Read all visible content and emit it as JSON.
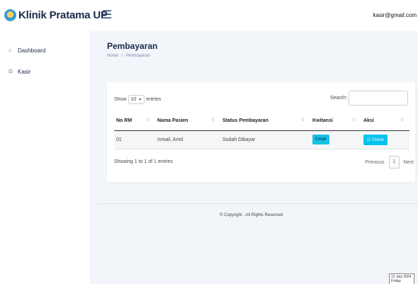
{
  "brand": {
    "name": "Klinik Pratama UP",
    "menu_icon": "hamburger-icon"
  },
  "user": {
    "email": "kasir@gmail.com"
  },
  "sidebar": {
    "items": [
      {
        "label": "Dashboard",
        "icon": "home-icon"
      },
      {
        "label": "Kasir",
        "icon": "cash-icon"
      }
    ]
  },
  "page": {
    "title": "Pembayaran",
    "breadcrumb": {
      "home": "Home",
      "sep": "/",
      "current": "Pembayaran"
    }
  },
  "table_controls": {
    "show_label": "Show",
    "length_value": "10",
    "entries_label": "entries",
    "search_label": "Search:",
    "search_value": ""
  },
  "table": {
    "headers": [
      "No RM",
      "Nama Pasien",
      "Status Pembayaran",
      "Kwitansi",
      "Aksi"
    ],
    "rows": [
      {
        "no_rm": "01",
        "nama": "Ismail, Amd",
        "status": "Sudah Dibayar",
        "kwitansi_btn": "Cetak",
        "aksi_btn": "Check"
      }
    ],
    "info": "Showing 1 to 1 of 1 entries"
  },
  "pagination": {
    "previous": "Previous",
    "current": "1",
    "next": "Next"
  },
  "footer": {
    "copyright": "© Copyright . All Rights Reserved"
  },
  "clock": {
    "date": "12 July 2024",
    "day": "Friday"
  },
  "colors": {
    "accent": "#19c1e6",
    "brand_text": "#1b2a4a",
    "background": "#f2f5fa"
  }
}
